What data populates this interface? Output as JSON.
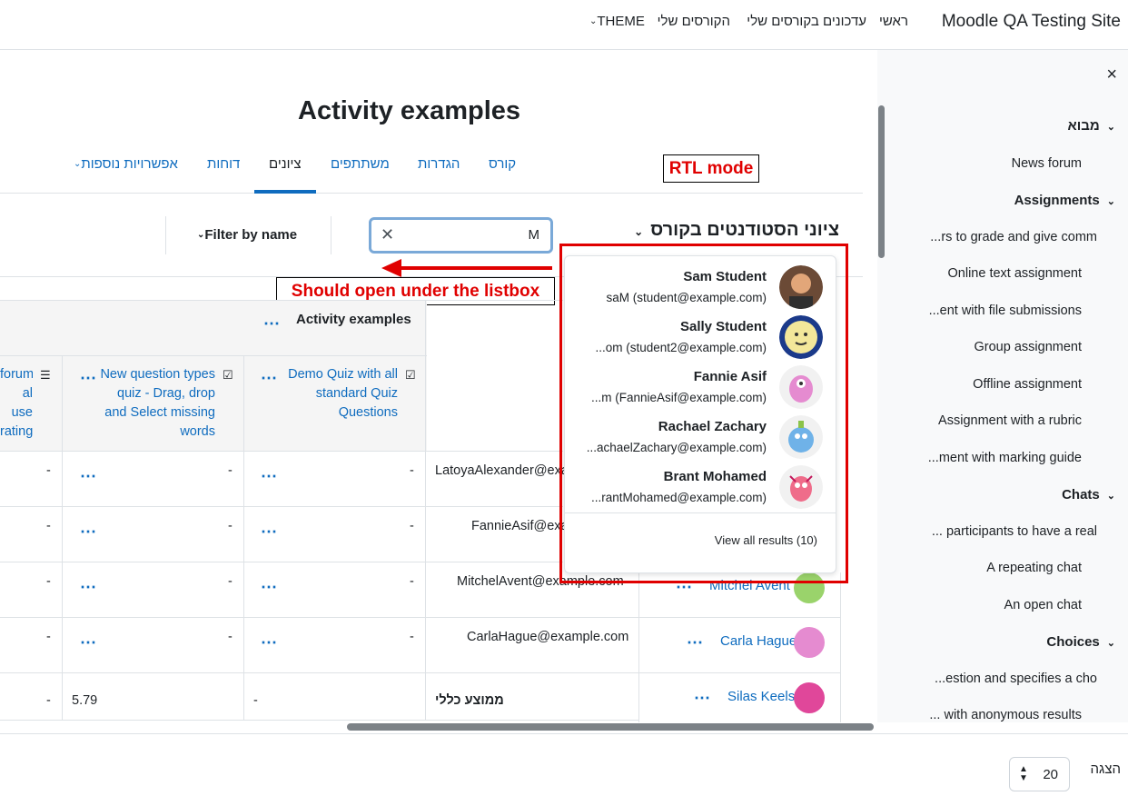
{
  "navbar": {
    "site_name": "Moodle QA Testing Site",
    "links": [
      "ראשי",
      "עדכונים בקורסים שלי",
      "הקורסים שלי",
      "THEME"
    ]
  },
  "drawer": {
    "close_label": "×",
    "sections": {
      "intro": "מבוא",
      "assignments": "Assignments",
      "chats": "Chats",
      "choices": "Choices"
    },
    "items": {
      "news": "News forum",
      "a1": "...rs to grade and give comm",
      "a2": "Online text assignment",
      "a3": "...ent with file submissions",
      "a4": "Group assignment",
      "a5": "Offline assignment",
      "a6": "Assignment with a rubric",
      "a7": "...ment with marking guide",
      "c1": "... participants to have a real",
      "c2": "A repeating chat",
      "c3": "An open chat",
      "ch1": "...estion and specifies a cho",
      "ch2": "... with anonymous results"
    }
  },
  "page": {
    "title": "Activity examples",
    "tabs": [
      "קורס",
      "הגדרות",
      "משתתפים",
      "ציונים",
      "דוחות",
      "אפשרויות נוספות"
    ],
    "active_tab": "ציונים",
    "grade_title": "ציוני הסטודנטים בקורס",
    "filter_label": "Filter by name",
    "search_value": "M"
  },
  "annotations": {
    "rtl_mode": "RTL mode",
    "should_open": "Should open under the listbox"
  },
  "table": {
    "category": "Activity examples",
    "columns": {
      "demo_quiz": "Demo Quiz with all standard Quiz Questions",
      "new_question": "New question types quiz - Drag, drop and Select missing words",
      "forum_a": "forum",
      "forum_b": "al use",
      "forum_c": "rating"
    },
    "rows": [
      {
        "email": "LatoyaAlexander@exa",
        "v1": "-",
        "v2": "-",
        "v3": "-"
      },
      {
        "email": "FannieAsif@exa",
        "v1": "-",
        "v2": "-",
        "v3": "-"
      },
      {
        "email": "MitchelAvent@example.com",
        "name": "Mitchel Avent",
        "v1": "-",
        "v2": "-",
        "v3": "-"
      },
      {
        "email": "CarlaHague@example.com",
        "name": "Carla Hague",
        "v1": "-",
        "v2": "-",
        "v3": "-"
      }
    ],
    "extra_user": "Silas Keels",
    "overall_label": "ממוצע כללי",
    "overall_a": "-",
    "overall_b": "5.79",
    "overall_c": "-"
  },
  "dropdown": {
    "results": [
      {
        "name": "Sam Student",
        "email": "saM (student@example.com)",
        "avatar_color": "#6b4a36"
      },
      {
        "name": "Sally Student",
        "email": "...om (student2@example.com)",
        "avatar_color": "#f3e79a"
      },
      {
        "name": "Fannie Asif",
        "email": "...m (FannieAsif@example.com)",
        "avatar_color": "#e58bd0"
      },
      {
        "name": "Rachael Zachary",
        "email": "...achaelZachary@example.com)",
        "avatar_color": "#6fb2e8"
      },
      {
        "name": "Brant Mohamed",
        "email": "...rantMohamed@example.com)",
        "avatar_color": "#ef6c8a"
      }
    ],
    "view_all": "View all results (10)"
  },
  "footer": {
    "show_label": "הצגה",
    "per_page": "20"
  },
  "colors": {
    "link": "#0f6cbf",
    "annotation_red": "#e00000",
    "focus_ring": "#7aa9d8"
  }
}
